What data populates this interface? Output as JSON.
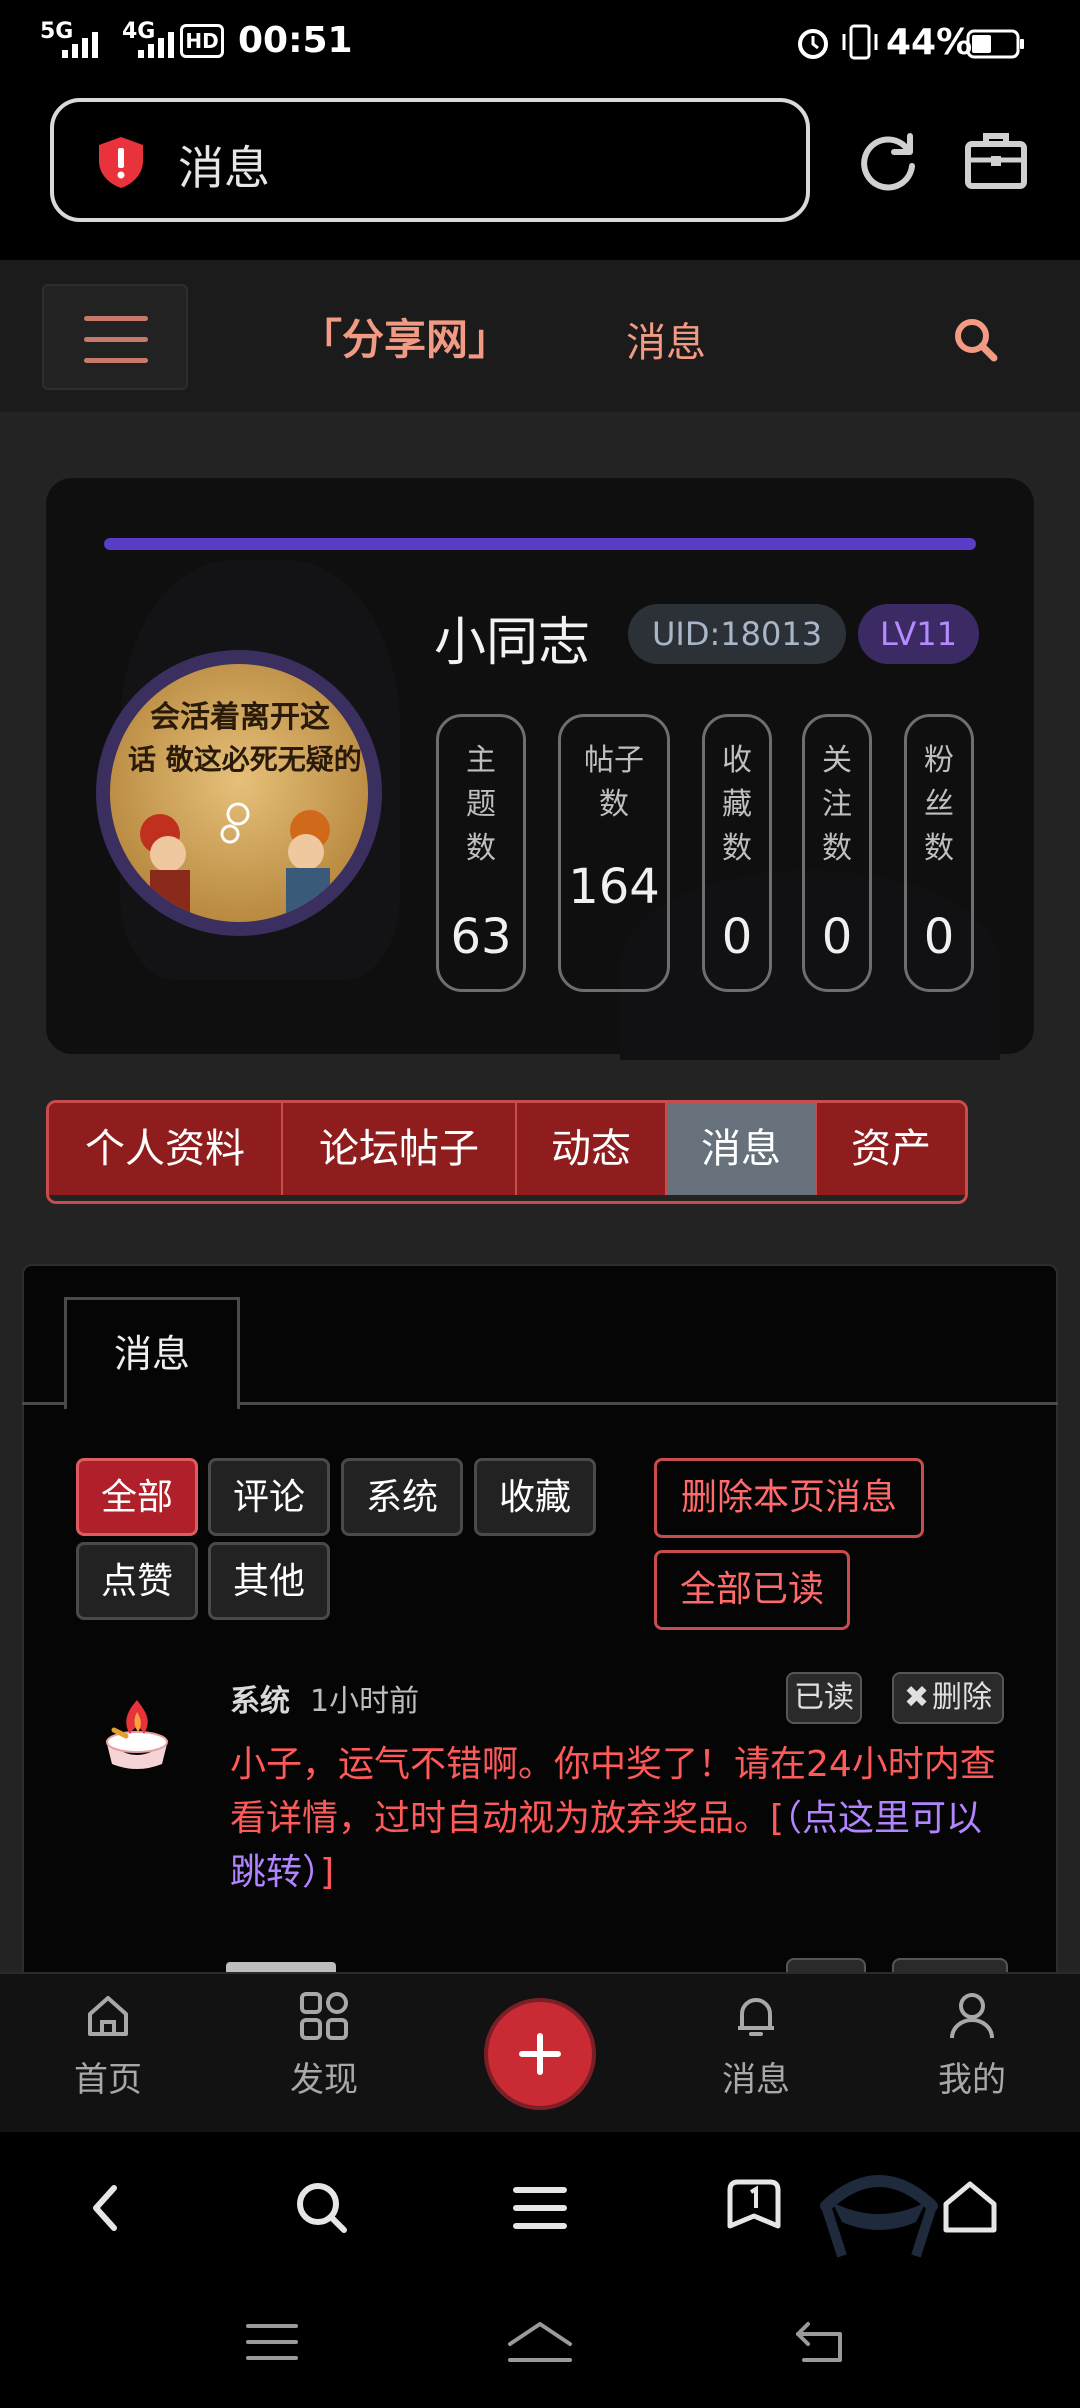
{
  "status_bar": {
    "network_1": "5G",
    "network_2": "4G",
    "hd": "HD",
    "time": "00:51",
    "battery": "44%"
  },
  "browser": {
    "url_text": "消息"
  },
  "site": {
    "brand": "「分享网」",
    "page": "消息"
  },
  "profile": {
    "username": "小同志",
    "uid": "UID:18013",
    "level": "LV11",
    "avatar_line1": "会活着离开这",
    "avatar_line2": "话 敬这必死无疑的",
    "stats": [
      {
        "label": "主题数",
        "value": "63"
      },
      {
        "label": "帖子数",
        "value": "164"
      },
      {
        "label": "收藏数",
        "value": "0"
      },
      {
        "label": "关注数",
        "value": "0"
      },
      {
        "label": "粉丝数",
        "value": "0"
      }
    ]
  },
  "tabs": [
    "个人资料",
    "论坛帖子",
    "动态",
    "消息",
    "资产"
  ],
  "panel": {
    "tab_label": "消息",
    "filters": [
      "全部",
      "评论",
      "系统",
      "收藏",
      "点赞",
      "其他"
    ],
    "delete_page": "删除本页消息",
    "mark_all_read": "全部已读"
  },
  "message": {
    "sender": "系统",
    "time": "1小时前",
    "read_label": "已读",
    "delete_label": "删除",
    "body": "小子，运气不错啊。你中奖了！请在24小时内查看详情，过时自动视为放弃奖品。[",
    "link": "（点这里可以跳转）",
    "body_end": "]"
  },
  "bottom_nav": {
    "home": "首页",
    "discover": "发现",
    "messages": "消息",
    "mine": "我的"
  },
  "colors": {
    "accent_red": "#c92a34",
    "brand_salmon": "#f29a84",
    "level_purple": "#5b3cc4"
  }
}
